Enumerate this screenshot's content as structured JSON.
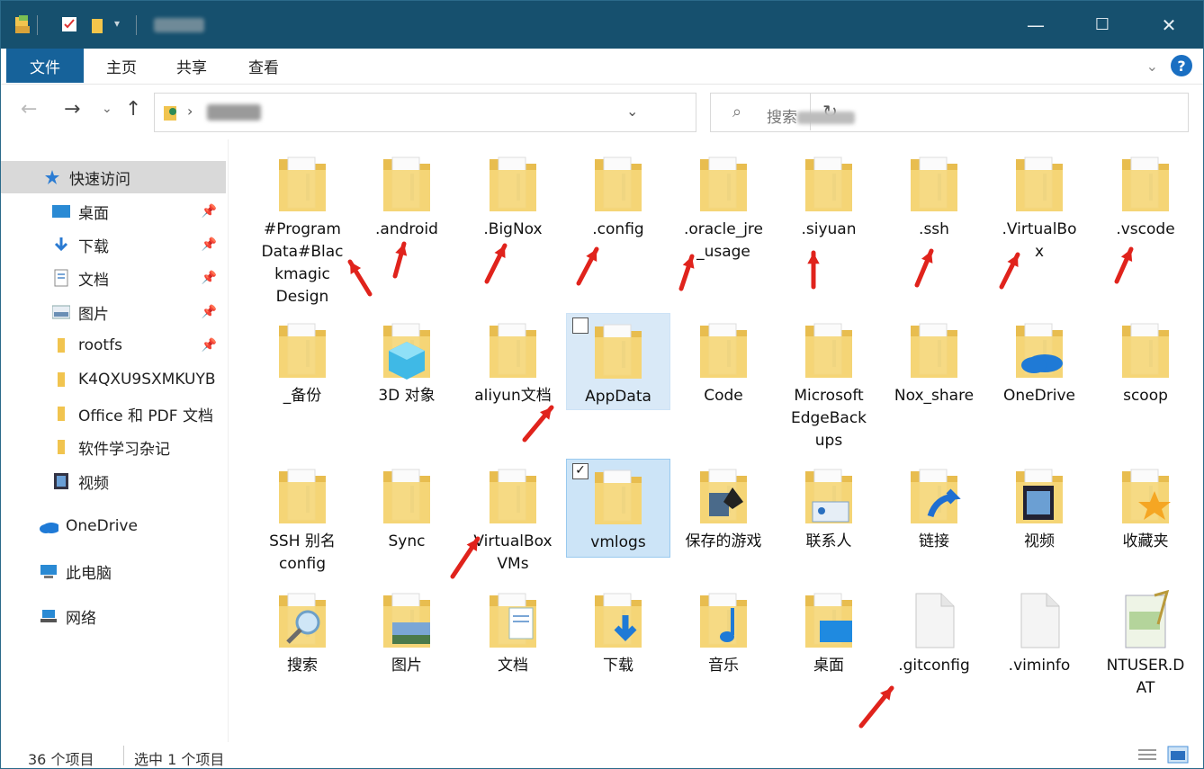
{
  "window": {
    "accent": "#16506e",
    "title_blurred": true,
    "controls": {
      "minimize": "—",
      "maximize": "☐",
      "close": "✕"
    }
  },
  "ribbon": {
    "tabs": [
      "文件",
      "主页",
      "共享",
      "查看"
    ]
  },
  "address": {
    "path_blurred": true,
    "search_placeholder": "搜索"
  },
  "sidebar": {
    "quick_access": "快速访问",
    "items": [
      {
        "label": "桌面",
        "icon": "desktop-icon",
        "pinned": true
      },
      {
        "label": "下载",
        "icon": "download-icon",
        "pinned": true
      },
      {
        "label": "文档",
        "icon": "document-icon",
        "pinned": true
      },
      {
        "label": "图片",
        "icon": "picture-icon",
        "pinned": true
      },
      {
        "label": "rootfs",
        "icon": "folder-icon",
        "pinned": true
      },
      {
        "label": "K4QXU9SXMKUYB",
        "icon": "folder-icon",
        "pinned": false
      },
      {
        "label": "Office 和 PDF 文档",
        "icon": "folder-icon",
        "pinned": false
      },
      {
        "label": "软件学习杂记",
        "icon": "folder-icon",
        "pinned": false
      },
      {
        "label": "视频",
        "icon": "video-icon",
        "pinned": false
      }
    ],
    "onedrive": "OneDrive",
    "this_pc": "此电脑",
    "network": "网络"
  },
  "files": [
    {
      "label": "#ProgramData#BlackmagicDesign",
      "display": [
        "#Program",
        "Data#Blac",
        "kmagic",
        "Design"
      ],
      "icon": "folder-icon",
      "arrow": true
    },
    {
      "label": ".android",
      "icon": "folder-icon",
      "arrow": true
    },
    {
      "label": ".BigNox",
      "icon": "folder-icon",
      "arrow": true
    },
    {
      "label": ".config",
      "icon": "folder-icon",
      "arrow": true
    },
    {
      "label": ".oracle_jre_usage",
      "display": [
        ".oracle_jre",
        "_usage"
      ],
      "icon": "folder-icon",
      "arrow": true
    },
    {
      "label": ".siyuan",
      "icon": "folder-icon",
      "arrow": true
    },
    {
      "label": ".ssh",
      "icon": "folder-icon",
      "arrow": true
    },
    {
      "label": ".VirtualBox",
      "display": [
        ".VirtualBo",
        "x"
      ],
      "icon": "folder-icon",
      "arrow": true
    },
    {
      "label": ".vscode",
      "icon": "folder-icon",
      "arrow": true
    },
    {
      "label": "_备份",
      "icon": "folder-icon"
    },
    {
      "label": "3D 对象",
      "icon": "3d-objects-icon"
    },
    {
      "label": "aliyun文档",
      "icon": "folder-icon",
      "arrow": true
    },
    {
      "label": "AppData",
      "icon": "folder-icon",
      "selected": true,
      "checked": false
    },
    {
      "label": "Code",
      "icon": "folder-icon"
    },
    {
      "label": "MicrosoftEdgeBackups",
      "display": [
        "Microsoft",
        "EdgeBack",
        "ups"
      ],
      "icon": "folder-icon"
    },
    {
      "label": "Nox_share",
      "icon": "folder-icon"
    },
    {
      "label": "OneDrive",
      "icon": "onedrive-icon"
    },
    {
      "label": "scoop",
      "icon": "folder-icon"
    },
    {
      "label": "SSH 别名 config",
      "display": [
        "SSH 别名",
        "config"
      ],
      "icon": "folder-icon"
    },
    {
      "label": "Sync",
      "icon": "folder-icon"
    },
    {
      "label": "VirtualBox VMs",
      "display": [
        "VirtualBox",
        "VMs"
      ],
      "icon": "folder-icon",
      "arrow": true
    },
    {
      "label": "vmlogs",
      "icon": "folder-icon",
      "selected": true,
      "checked": true
    },
    {
      "label": "保存的游戏",
      "icon": "saved-games-icon"
    },
    {
      "label": "联系人",
      "icon": "contacts-icon"
    },
    {
      "label": "链接",
      "icon": "links-icon"
    },
    {
      "label": "视频",
      "icon": "videos-icon"
    },
    {
      "label": "收藏夹",
      "icon": "favorites-icon"
    },
    {
      "label": "搜索",
      "icon": "searches-icon"
    },
    {
      "label": "图片",
      "icon": "pictures-icon"
    },
    {
      "label": "文档",
      "icon": "documents-icon"
    },
    {
      "label": "下载",
      "icon": "downloads-icon"
    },
    {
      "label": "音乐",
      "icon": "music-icon"
    },
    {
      "label": "桌面",
      "icon": "desktop-folder-icon"
    },
    {
      "label": ".gitconfig",
      "icon": "file-icon",
      "arrow": true
    },
    {
      "label": ".viminfo",
      "icon": "file-icon"
    },
    {
      "label": "NTUSER.DAT",
      "display": [
        "NTUSER.D",
        "AT"
      ],
      "icon": "dat-file-icon"
    }
  ],
  "status": {
    "count": "36 个项目",
    "selected": "选中 1 个项目"
  },
  "colors": {
    "folder": "#f5d77a",
    "folder_dark": "#e8bd4f",
    "selection": "#cce4f7",
    "arrow": "#e0231c"
  }
}
